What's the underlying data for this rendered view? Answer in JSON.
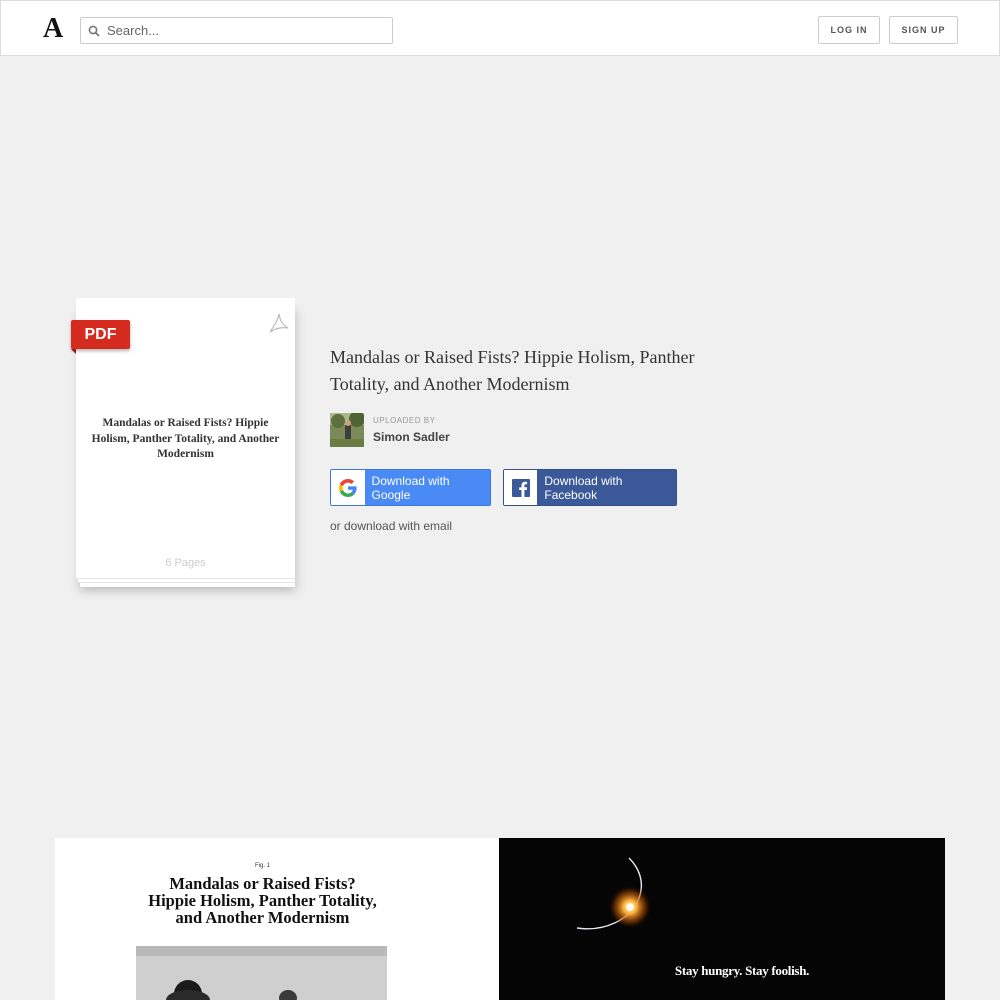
{
  "header": {
    "logo": "A",
    "search_placeholder": "Search...",
    "login_label": "LOG IN",
    "signup_label": "SIGN UP"
  },
  "preview": {
    "badge": "PDF",
    "title": "Mandalas or Raised Fists? Hippie Holism, Panther Totality, and Another Modernism",
    "pages": "6 Pages"
  },
  "document": {
    "title": "Mandalas or Raised Fists? Hippie Holism, Panther Totality, and Another Modernism",
    "uploaded_by_label": "UPLOADED BY",
    "uploader": "Simon Sadler",
    "google_label": "Download with Google",
    "facebook_label": "Download with Facebook",
    "email_label": "or download with email"
  },
  "page_preview": {
    "fig_label": "Fig. 1",
    "heading_line1": "Mandalas or Raised Fists?",
    "heading_line2": "Hippie Holism, Panther Totality,",
    "heading_line3": "and Another Modernism",
    "slogan": "Stay hungry. Stay foolish."
  },
  "colors": {
    "google_blue": "#4a8af4",
    "facebook_blue": "#3b5998",
    "pdf_red": "#d52b1e"
  }
}
